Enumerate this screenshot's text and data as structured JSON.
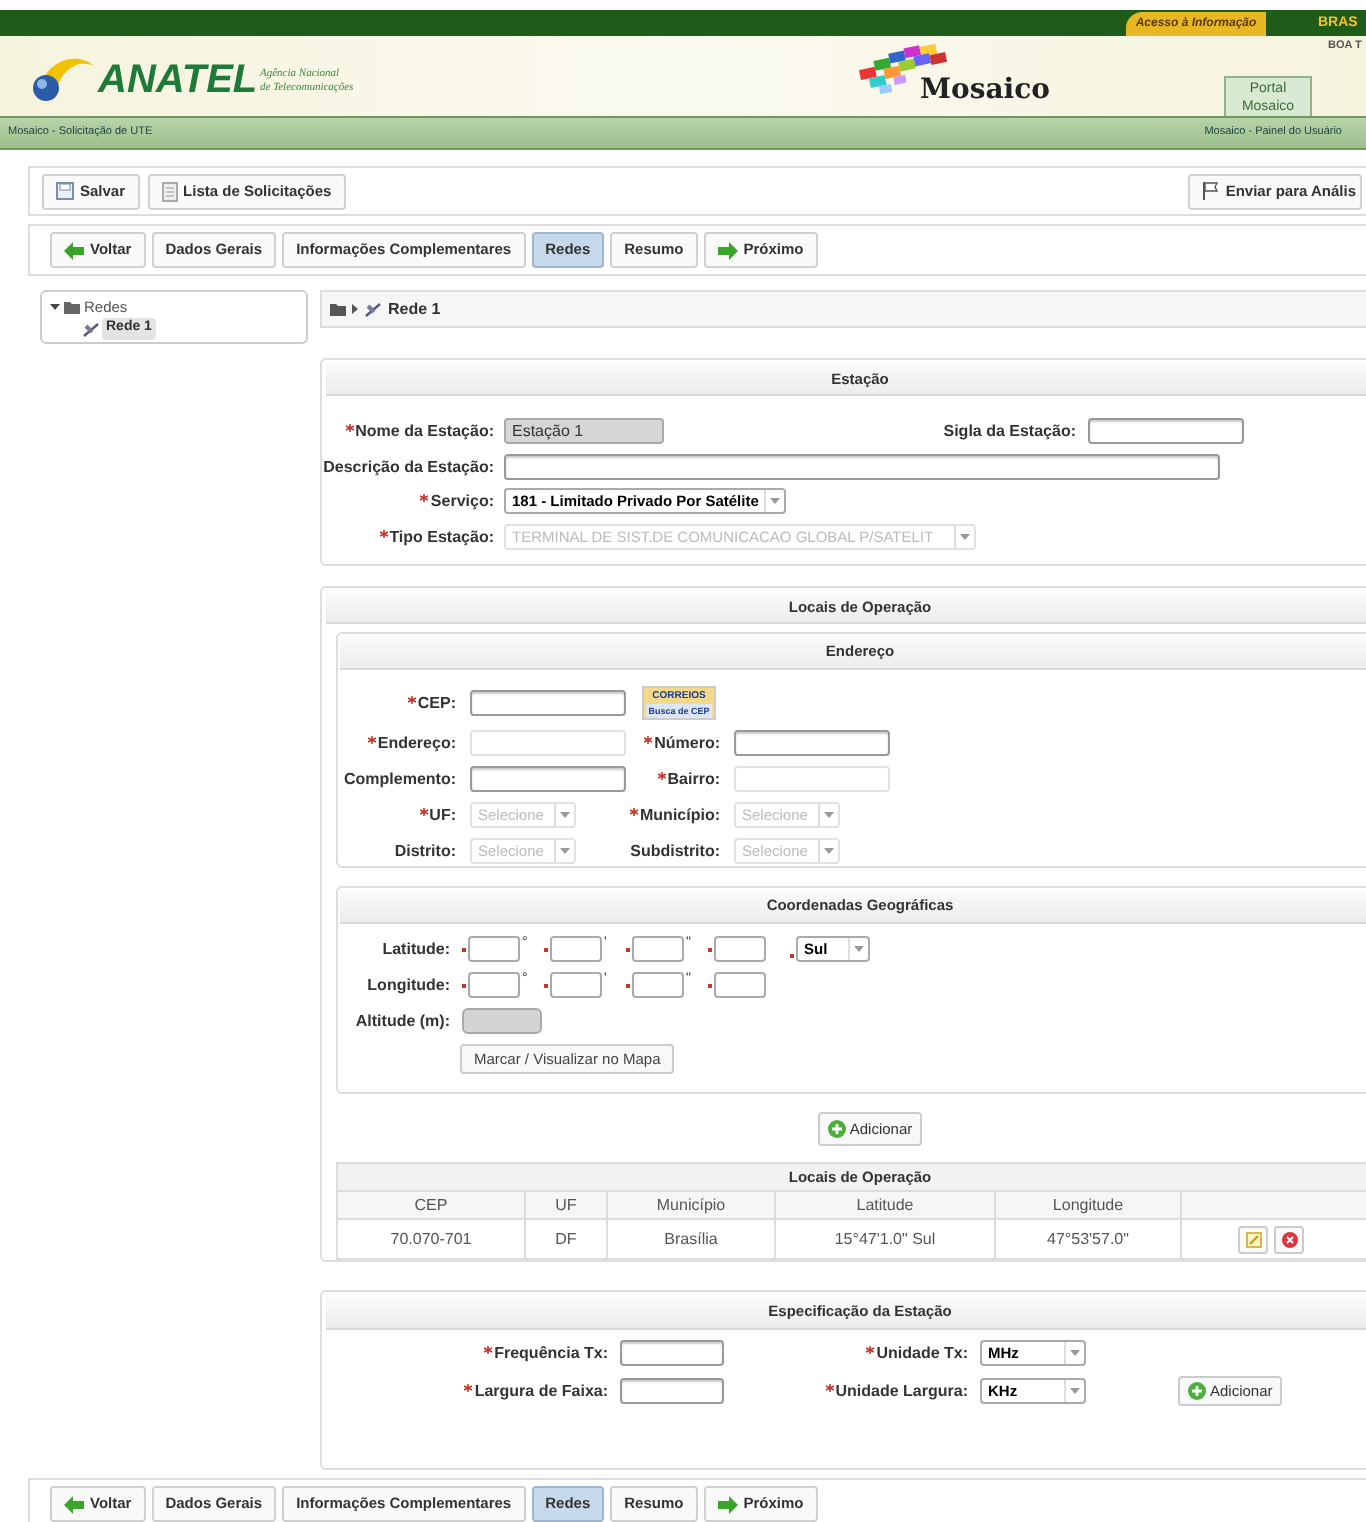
{
  "top_bar": {
    "access_link": "Acesso à Informação",
    "brand_text": "BRAS",
    "greeting": "BOA T"
  },
  "header": {
    "logo_text": "ANATEL",
    "agency_line_1": "Agência Nacional",
    "agency_line_2": "de Telecomunicações",
    "app_name": "Mosaico",
    "portal_tab": "Portal Mosaico"
  },
  "nav_bar": {
    "page_title": "Mosaico - Solicitação de UTE",
    "user_panel_link": "Mosaico - Painel do Usuário"
  },
  "toolbar": {
    "buttons": [
      {
        "label": "Salvar",
        "kind": "save"
      },
      {
        "label": "Lista de Solicitações",
        "kind": "list"
      }
    ],
    "submit_button": "Enviar para Anális"
  },
  "wizard_tabs": [
    {
      "label": "Voltar",
      "kind": "back",
      "selected": false
    },
    {
      "label": "Dados Gerais",
      "kind": "step",
      "selected": false
    },
    {
      "label": "Informações Complementares",
      "kind": "step",
      "selected": false
    },
    {
      "label": "Redes",
      "kind": "step",
      "selected": true
    },
    {
      "label": "Resumo",
      "kind": "step",
      "selected": false
    },
    {
      "label": "Próximo",
      "kind": "next",
      "selected": false
    }
  ],
  "bottom_wizard_tabs": [
    {
      "label": "Voltar",
      "kind": "back",
      "selected": false
    },
    {
      "label": "Dados Gerais",
      "kind": "step",
      "selected": false
    },
    {
      "label": "Informações Complementares",
      "kind": "step",
      "selected": false
    },
    {
      "label": "Redes",
      "kind": "step",
      "selected": true
    },
    {
      "label": "Resumo",
      "kind": "step",
      "selected": false
    },
    {
      "label": "Próximo",
      "kind": "next",
      "selected": false
    }
  ],
  "tree": [
    {
      "label": "Redes",
      "expanded": true,
      "children": [
        {
          "label": "Rede 1",
          "selected": true
        }
      ]
    }
  ],
  "breadcrumb": "Rede 1",
  "station": {
    "title": "Estação",
    "fields": [
      {
        "label": "Nome da Estação:",
        "required": true,
        "kind": "text",
        "value": "Estação 1",
        "disabled": true
      },
      {
        "label": "Sigla da Estação:",
        "required": false,
        "kind": "text",
        "disabled": false
      },
      {
        "label": "Descrição da Estação:",
        "required": false,
        "kind": "text",
        "disabled": false
      },
      {
        "label": "Serviço:",
        "required": true,
        "kind": "select",
        "value": "181 - Limitado Privado Por Satélite",
        "disabled": false
      },
      {
        "label": "Tipo Estação:",
        "required": true,
        "kind": "select",
        "value": "TERMINAL DE SIST.DE COMUNICACAO GLOBAL P/SATELIT",
        "disabled": true
      }
    ]
  },
  "operation_sites": {
    "title": "Locais de Operação",
    "address": {
      "title": "Endereço",
      "cep_lookup": {
        "brand": "CORREIOS",
        "caption": "Busca de CEP"
      },
      "fields": [
        {
          "label": "CEP:",
          "required": true,
          "kind": "text",
          "disabled": false
        },
        {
          "label": "Endereço:",
          "required": true,
          "kind": "text",
          "disabled": true
        },
        {
          "label": "Número:",
          "required": true,
          "kind": "text",
          "disabled": false
        },
        {
          "label": "Complemento:",
          "required": false,
          "kind": "text",
          "disabled": false
        },
        {
          "label": "Bairro:",
          "required": true,
          "kind": "text",
          "disabled": true
        },
        {
          "label": "UF:",
          "required": true,
          "kind": "select",
          "value": "Selecione",
          "disabled": true
        },
        {
          "label": "Município:",
          "required": true,
          "kind": "select",
          "value": "Selecione",
          "disabled": true
        },
        {
          "label": "Distrito:",
          "required": false,
          "kind": "select",
          "value": "Selecione",
          "disabled": true
        },
        {
          "label": "Subdistrito:",
          "required": false,
          "kind": "select",
          "value": "Selecione",
          "disabled": true
        }
      ]
    },
    "coordinates": {
      "title": "Coordenadas Geográficas",
      "latitude": {
        "label": "Latitude:",
        "parts": [
          {
            "unit": "°",
            "required": true
          },
          {
            "unit": "'",
            "required": true
          },
          {
            "unit": "\"",
            "required": true
          },
          {
            "required": true
          }
        ],
        "hemisphere": "Sul"
      },
      "longitude": {
        "label": "Longitude:",
        "parts": [
          {
            "unit": "°",
            "required": true
          },
          {
            "unit": "'",
            "required": true
          },
          {
            "unit": "\"",
            "required": true
          },
          {
            "required": true
          }
        ]
      },
      "altitude": {
        "label": "Altitude (m):",
        "disabled": true
      },
      "map_button": "Marcar / Visualizar no Mapa"
    },
    "add_button": "Adicionar",
    "table": {
      "title": "Locais de Operação",
      "columns": [
        "CEP",
        "UF",
        "Município",
        "Latitude",
        "Longitude"
      ],
      "rows": [
        {
          "cells": [
            "70.070-701",
            "DF",
            "Brasília",
            "15°47'1.0\" Sul",
            "47°53'57.0\""
          ]
        }
      ]
    }
  },
  "specification": {
    "title": "Especificação da Estação",
    "fields": [
      {
        "label": "Frequência Tx:",
        "required": true,
        "kind": "text"
      },
      {
        "label": "Unidade Tx:",
        "required": true,
        "kind": "select",
        "value": "MHz"
      },
      {
        "label": "Largura de Faixa:",
        "required": true,
        "kind": "text"
      },
      {
        "label": "Unidade Largura:",
        "required": true,
        "kind": "select",
        "value": "KHz"
      }
    ],
    "add_button": "Adicionar"
  }
}
